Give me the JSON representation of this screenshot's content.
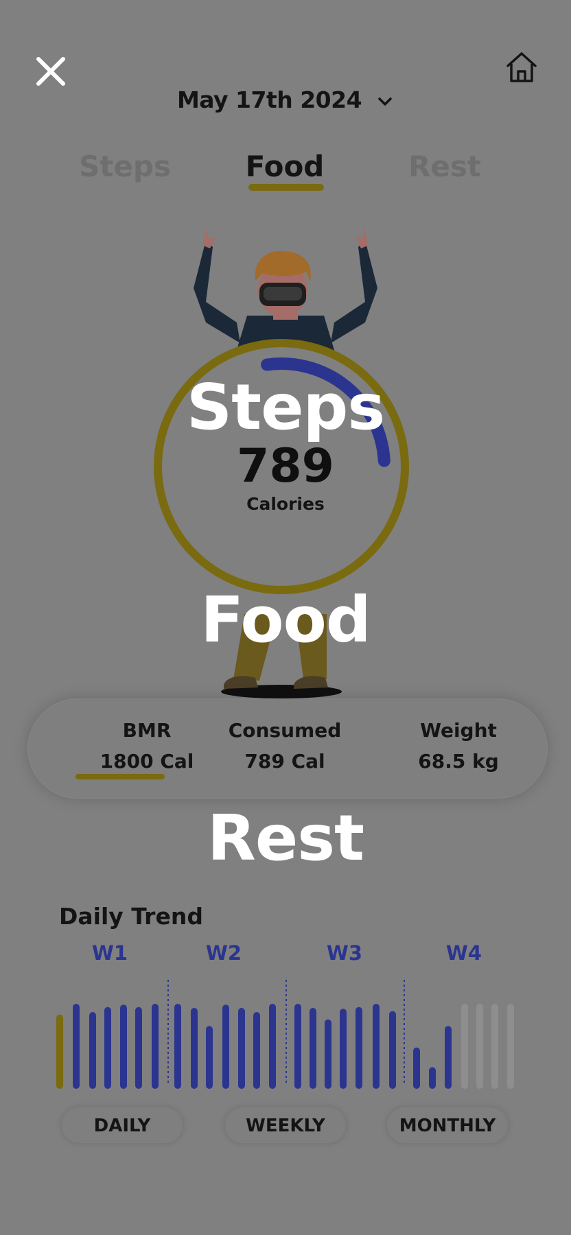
{
  "header": {
    "close_icon": "close-icon",
    "home_icon": "home-icon",
    "date_label": "May 17th 2024",
    "date_chevron_icon": "chevron-down-icon"
  },
  "tabs": [
    {
      "label": "Steps",
      "active": false
    },
    {
      "label": "Food",
      "active": true
    },
    {
      "label": "Rest",
      "active": false
    }
  ],
  "ring": {
    "value": "789",
    "unit": "Calories",
    "progress_fraction": 0.18,
    "ring_color": "#7a6a10",
    "progress_color": "#2b3590"
  },
  "overlay_labels": {
    "steps": "Steps",
    "food": "Food",
    "rest": "Rest"
  },
  "stats": {
    "bmr_title": "BMR",
    "bmr_value": "1800 Cal",
    "consumed_title": "Consumed",
    "consumed_value": "789 Cal",
    "weight_title": "Weight",
    "weight_value": "68.5 kg"
  },
  "trend": {
    "title": "Daily Trend",
    "weeks": [
      "W1",
      "W2",
      "W3",
      "W4"
    ],
    "bars": [
      {
        "value": 0.82,
        "state": "current"
      },
      {
        "value": 0.95,
        "state": "done"
      },
      {
        "value": 0.85,
        "state": "done"
      },
      {
        "value": 0.91,
        "state": "done"
      },
      {
        "value": 0.94,
        "state": "done"
      },
      {
        "value": 0.91,
        "state": "done"
      },
      {
        "value": 0.95,
        "state": "done"
      },
      {
        "value": 0.95,
        "state": "done"
      },
      {
        "value": 0.9,
        "state": "done"
      },
      {
        "value": 0.68,
        "state": "done"
      },
      {
        "value": 0.94,
        "state": "done"
      },
      {
        "value": 0.9,
        "state": "done"
      },
      {
        "value": 0.85,
        "state": "done"
      },
      {
        "value": 0.95,
        "state": "done"
      },
      {
        "value": 0.95,
        "state": "done"
      },
      {
        "value": 0.9,
        "state": "done"
      },
      {
        "value": 0.76,
        "state": "done"
      },
      {
        "value": 0.89,
        "state": "done"
      },
      {
        "value": 0.91,
        "state": "done"
      },
      {
        "value": 0.95,
        "state": "done"
      },
      {
        "value": 0.86,
        "state": "done"
      },
      {
        "value": 0.42,
        "state": "done"
      },
      {
        "value": 0.18,
        "state": "done"
      },
      {
        "value": 0.68,
        "state": "done"
      },
      {
        "value": 0.95,
        "state": "future"
      },
      {
        "value": 0.95,
        "state": "future"
      },
      {
        "value": 0.95,
        "state": "future"
      },
      {
        "value": 0.95,
        "state": "future"
      }
    ],
    "colors": {
      "current": "#7a6a10",
      "done": "#2b3590",
      "future": "#8e8e8e",
      "divider": "#2b3590"
    }
  },
  "periods": [
    "DAILY",
    "WEEKLY",
    "MONTHLY"
  ]
}
